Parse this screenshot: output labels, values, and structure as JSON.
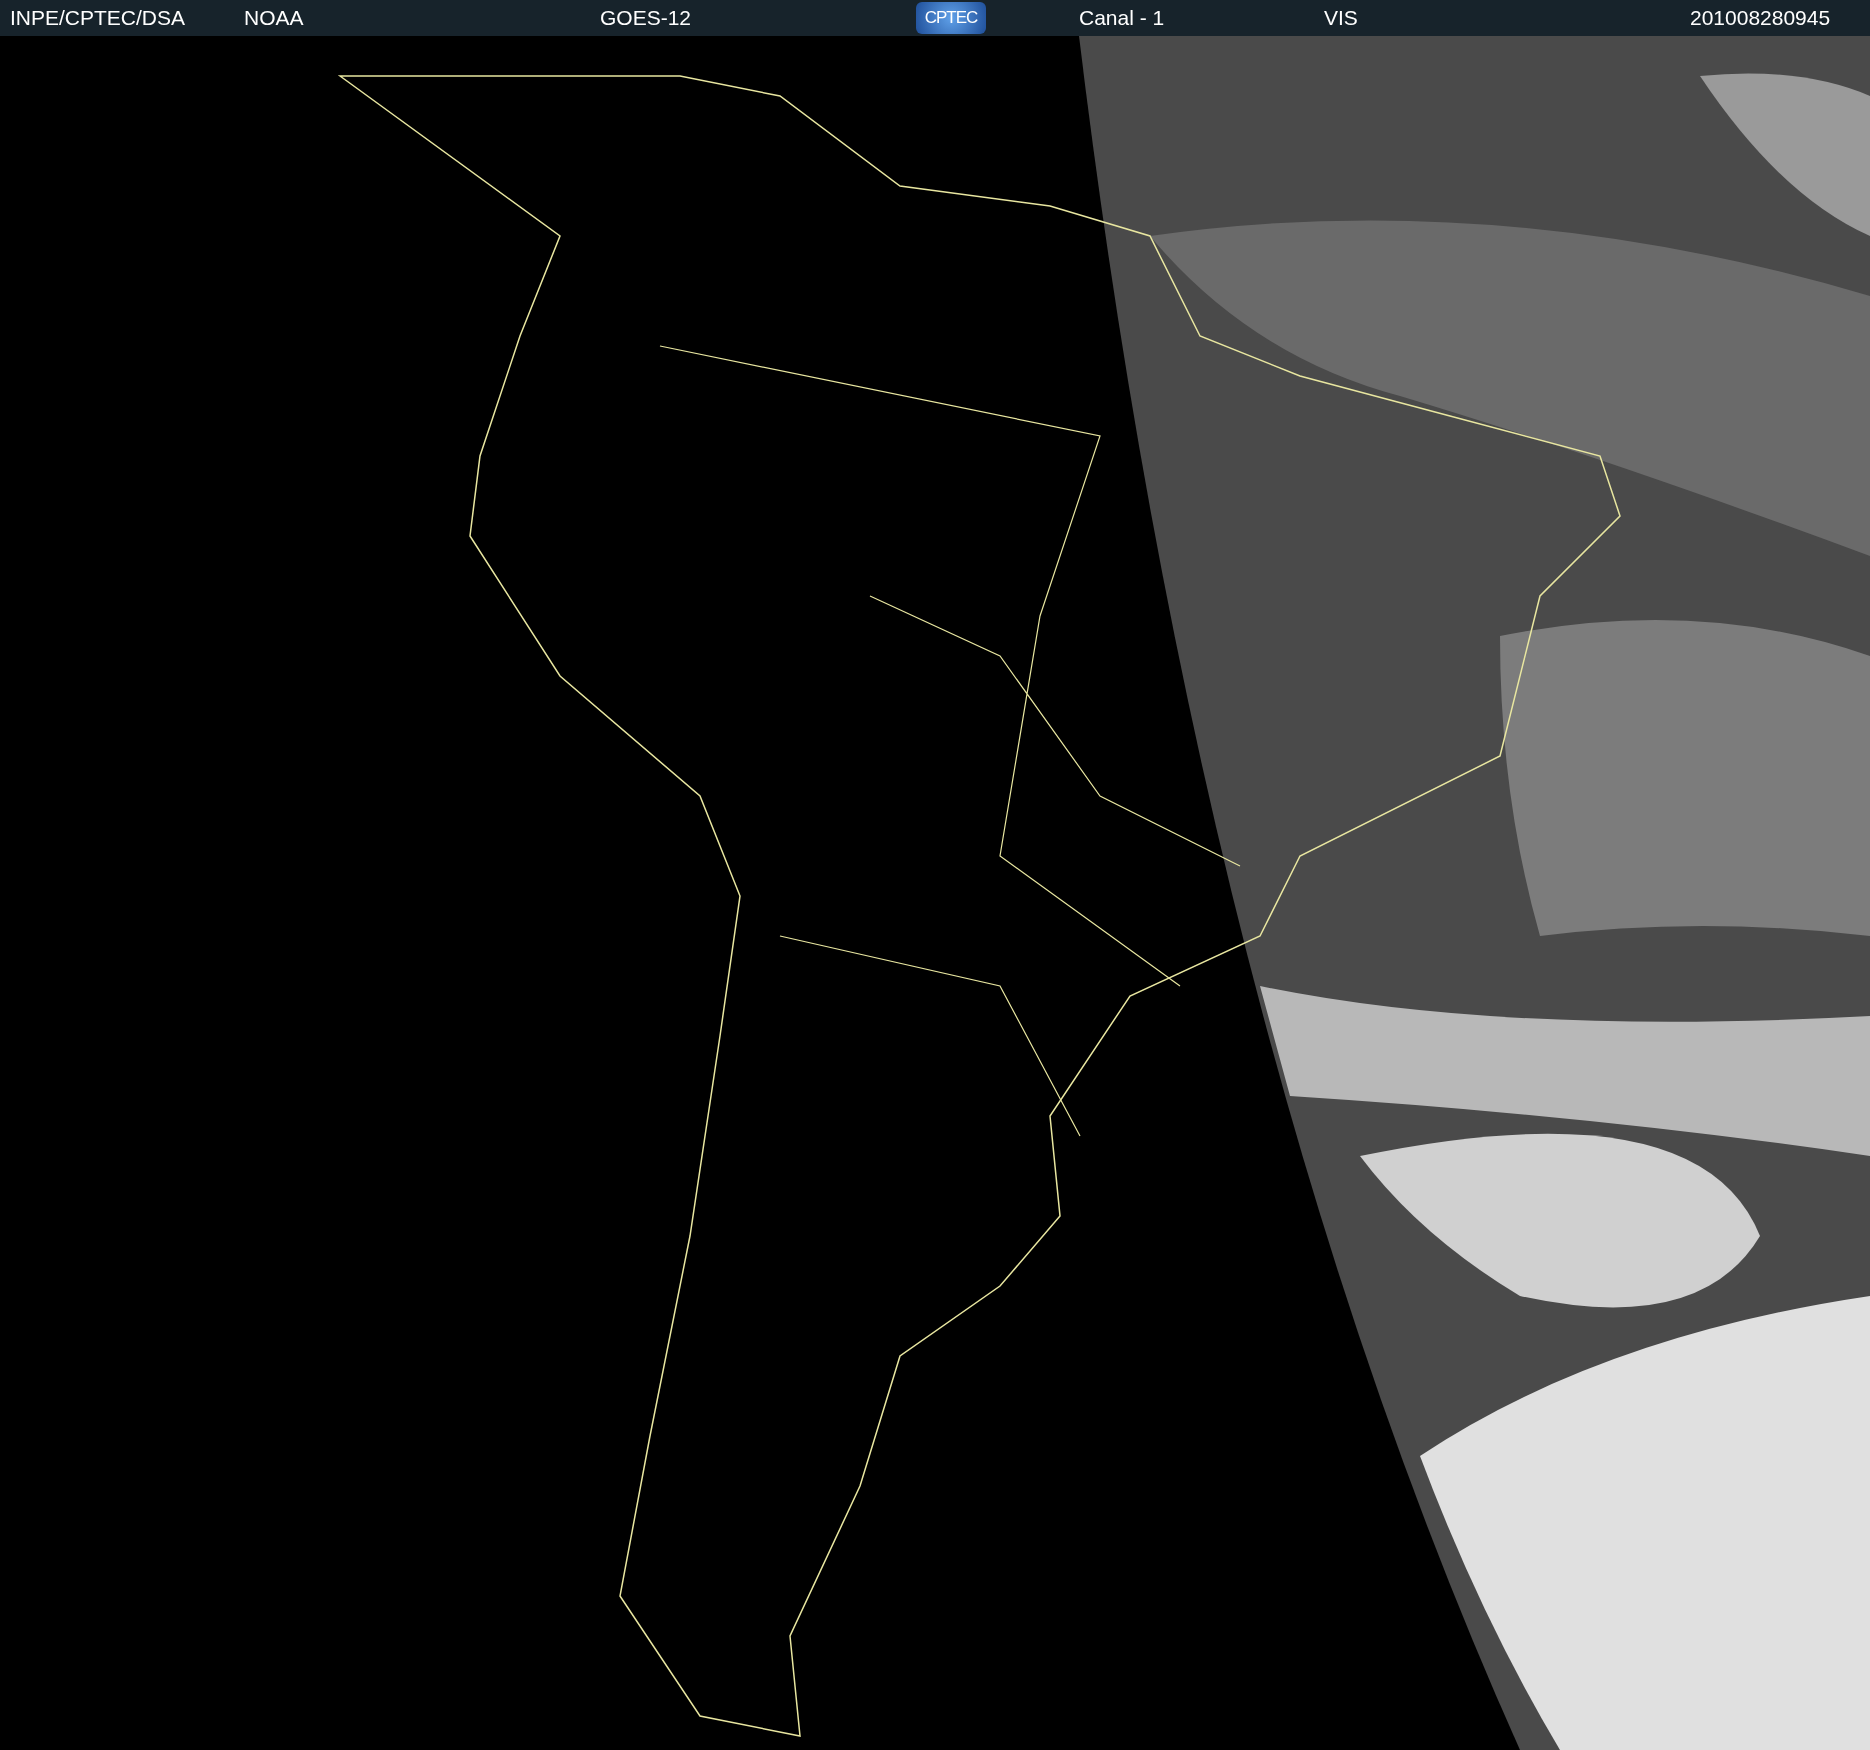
{
  "header": {
    "source": "INPE/CPTEC/DSA",
    "agency": "NOAA",
    "satellite": "GOES-12",
    "logo_text": "CPTEC",
    "channel": "Canal - 1",
    "band": "VIS",
    "timestamp": "201008280945"
  }
}
